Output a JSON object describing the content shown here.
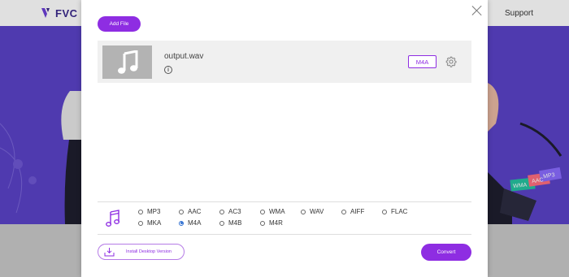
{
  "background": {
    "logo_text": "FVC",
    "nav_support": "Support",
    "deco_tags": [
      "WMA",
      "AAC",
      "MP3"
    ]
  },
  "modal": {
    "add_file_label": "Add File",
    "file": {
      "name": "output.wav",
      "format_badge": "M4A"
    },
    "formats": [
      {
        "label": "MP3",
        "checked": false
      },
      {
        "label": "AAC",
        "checked": false
      },
      {
        "label": "AC3",
        "checked": false
      },
      {
        "label": "WMA",
        "checked": false
      },
      {
        "label": "WAV",
        "checked": false
      },
      {
        "label": "AIFF",
        "checked": false
      },
      {
        "label": "FLAC",
        "checked": false
      },
      {
        "label": "MKA",
        "checked": false
      },
      {
        "label": "M4A",
        "checked": true
      },
      {
        "label": "M4B",
        "checked": false
      },
      {
        "label": "M4R",
        "checked": false
      }
    ],
    "install_label": "Install Desktop Version",
    "convert_label": "Convert"
  },
  "icons": {
    "close": "close-icon",
    "music_thumb": "music-note-icon",
    "info": "info-icon",
    "settings": "gear-icon",
    "audio_formats": "music-note-icon",
    "download": "download-icon"
  },
  "colors": {
    "accent": "#8e2de2",
    "hero": "#5b43c8",
    "radio_selected": "#2f6fd1"
  }
}
